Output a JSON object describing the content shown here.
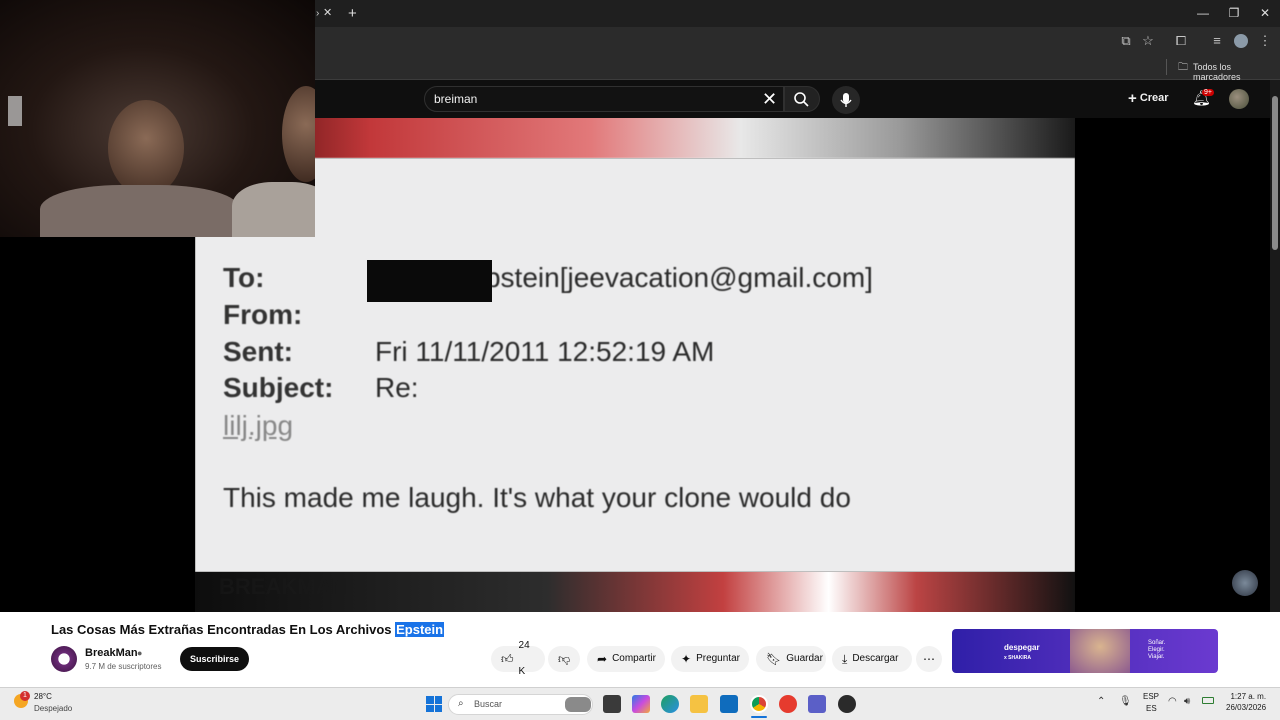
{
  "browser": {
    "bookmarks_all": "Todos los marcadores"
  },
  "masthead": {
    "search_value": "breiman",
    "create_label": "Crear",
    "notif_badge": "9+"
  },
  "video_frame": {
    "to_label": "To:",
    "to_value": "Jeffrey Epstein[jeevacation@gmail.com]",
    "from_label": "From:",
    "sent_label": "Sent:",
    "sent_value": "Fri 11/11/2011 12:52:19 AM",
    "subject_label": "Subject:",
    "subject_value": "Re:",
    "attachment": "lilj.jpg",
    "body": "This made me laugh. It's what your clone would do",
    "watermark": "BREAKMAN"
  },
  "video": {
    "title_main": "Las Cosas Más Extrañas Encontradas En Los Archivos ",
    "title_highlight": "Epstein",
    "channel": "BreakMan",
    "subscribers": "9.7 M de suscriptores",
    "subscribe_label": "Suscribirse",
    "likes": "24 K",
    "share_label": "Compartir",
    "ask_label": "Preguntar",
    "save_label": "Guardar",
    "download_label": "Descargar"
  },
  "ad": {
    "brand": "despegar",
    "partner": "x SHAKIRA",
    "tagline": [
      "Soñar.",
      "Elegir.",
      "Viajar."
    ]
  },
  "taskbar": {
    "weather_temp": "28°C",
    "weather_desc": "Despejado",
    "weather_badge": "1",
    "search_placeholder": "Buscar",
    "lang_top": "ESP",
    "lang_bottom": "ES",
    "time": "1:27 a. m.",
    "date": "26/03/2026"
  }
}
